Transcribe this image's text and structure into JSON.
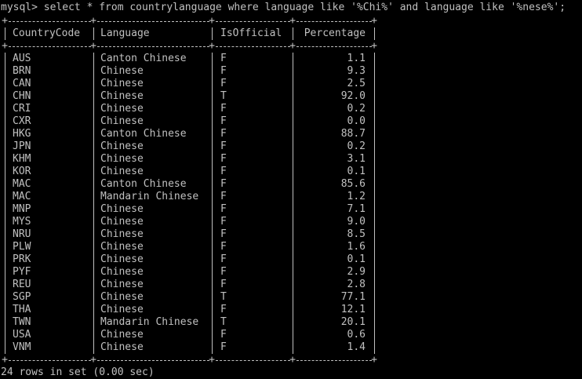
{
  "prompt": {
    "text": "mysql> select * from countrylanguage where language like '%Chi%' and language like '%nese%';"
  },
  "table": {
    "columns": [
      "CountryCode",
      "Language",
      "IsOfficial",
      "Percentage"
    ],
    "rows": [
      [
        "AUS",
        "Canton Chinese",
        "F",
        "1.1"
      ],
      [
        "BRN",
        "Chinese",
        "F",
        "9.3"
      ],
      [
        "CAN",
        "Chinese",
        "F",
        "2.5"
      ],
      [
        "CHN",
        "Chinese",
        "T",
        "92.0"
      ],
      [
        "CRI",
        "Chinese",
        "F",
        "0.2"
      ],
      [
        "CXR",
        "Chinese",
        "F",
        "0.0"
      ],
      [
        "HKG",
        "Canton Chinese",
        "F",
        "88.7"
      ],
      [
        "JPN",
        "Chinese",
        "F",
        "0.2"
      ],
      [
        "KHM",
        "Chinese",
        "F",
        "3.1"
      ],
      [
        "KOR",
        "Chinese",
        "F",
        "0.1"
      ],
      [
        "MAC",
        "Canton Chinese",
        "F",
        "85.6"
      ],
      [
        "MAC",
        "Mandarin Chinese",
        "F",
        "1.2"
      ],
      [
        "MNP",
        "Chinese",
        "F",
        "7.1"
      ],
      [
        "MYS",
        "Chinese",
        "F",
        "9.0"
      ],
      [
        "NRU",
        "Chinese",
        "F",
        "8.5"
      ],
      [
        "PLW",
        "Chinese",
        "F",
        "1.6"
      ],
      [
        "PRK",
        "Chinese",
        "F",
        "0.1"
      ],
      [
        "PYF",
        "Chinese",
        "F",
        "2.9"
      ],
      [
        "REU",
        "Chinese",
        "F",
        "2.8"
      ],
      [
        "SGP",
        "Chinese",
        "T",
        "77.1"
      ],
      [
        "THA",
        "Chinese",
        "F",
        "12.1"
      ],
      [
        "TWN",
        "Mandarin Chinese",
        "T",
        "20.1"
      ],
      [
        "USA",
        "Chinese",
        "F",
        "0.6"
      ],
      [
        "VNM",
        "Chinese",
        "F",
        "1.4"
      ]
    ]
  },
  "status": {
    "text": "24 rows in set (0.00 sec)"
  },
  "colors": {
    "background": "#000000",
    "text": "#c0c0c0"
  }
}
